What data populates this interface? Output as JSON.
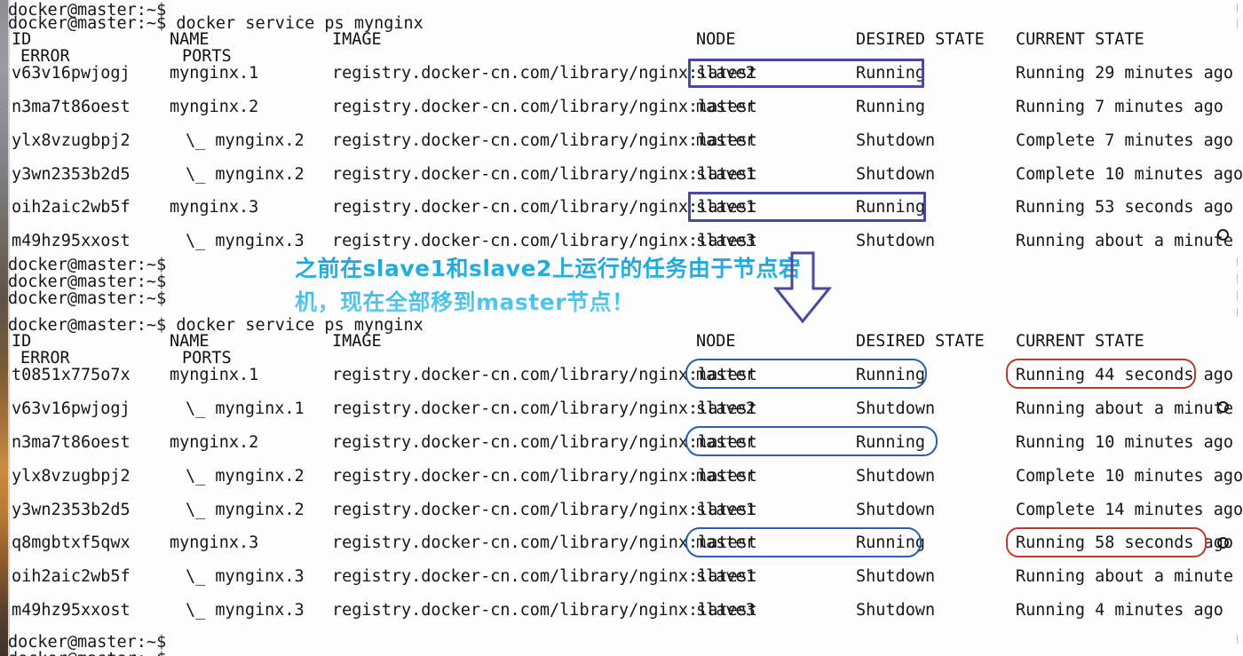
{
  "terminal": {
    "prompt": "docker@master:~$",
    "command": "docker service ps mynginx",
    "headers": {
      "id": "ID",
      "name": "NAME",
      "image": "IMAGE",
      "node": "NODE",
      "desired_state": "DESIRED STATE",
      "current_state": "CURRENT STATE",
      "error": "ERROR",
      "ports": "PORTS"
    }
  },
  "block1": {
    "blank_prompt": "docker@master:~$",
    "command_line": "docker@master:~$ docker service ps mynginx",
    "rows": [
      {
        "id": "v63v16pwjogj",
        "name": "mynginx.1",
        "image": "registry.docker-cn.com/library/nginx:latest",
        "node": "slave2",
        "desired": "Running",
        "current": "Running 29 minutes ago"
      },
      {
        "id": "n3ma7t86oest",
        "name": "mynginx.2",
        "image": "registry.docker-cn.com/library/nginx:latest",
        "node": "master",
        "desired": "Running",
        "current": "Running 7 minutes ago"
      },
      {
        "id": "ylx8vzugbpj2",
        "name": "\\_ mynginx.2",
        "image": "registry.docker-cn.com/library/nginx:latest",
        "node": "master",
        "desired": "Shutdown",
        "current": "Complete 7 minutes ago"
      },
      {
        "id": "y3wn2353b2d5",
        "name": "\\_ mynginx.2",
        "image": "registry.docker-cn.com/library/nginx:latest",
        "node": "slave1",
        "desired": "Shutdown",
        "current": "Complete 10 minutes ago"
      },
      {
        "id": "oih2aic2wb5f",
        "name": "mynginx.3",
        "image": "registry.docker-cn.com/library/nginx:latest",
        "node": "slave1",
        "desired": "Running",
        "current": "Running 53 seconds ago"
      },
      {
        "id": "m49hz95xxost",
        "name": "\\_ mynginx.3",
        "image": "registry.docker-cn.com/library/nginx:latest",
        "node": "slave3",
        "desired": "Shutdown",
        "current": "Running about a minute ago"
      }
    ]
  },
  "block2": {
    "blank_prompts": [
      "docker@master:~$",
      "docker@master:~$",
      "docker@master:~$"
    ],
    "command_line": "docker@master:~$ docker service ps mynginx",
    "rows": [
      {
        "id": "t0851x775o7x",
        "name": "mynginx.1",
        "image": "registry.docker-cn.com/library/nginx:latest",
        "node": "master",
        "desired": "Running",
        "current": "Running 44 seconds ago"
      },
      {
        "id": "v63v16pwjogj",
        "name": "\\_ mynginx.1",
        "image": "registry.docker-cn.com/library/nginx:latest",
        "node": "slave2",
        "desired": "Shutdown",
        "current": "Running about a minute ago"
      },
      {
        "id": "n3ma7t86oest",
        "name": "mynginx.2",
        "image": "registry.docker-cn.com/library/nginx:latest",
        "node": "master",
        "desired": "Running",
        "current": "Running 10 minutes ago"
      },
      {
        "id": "ylx8vzugbpj2",
        "name": "\\_ mynginx.2",
        "image": "registry.docker-cn.com/library/nginx:latest",
        "node": "master",
        "desired": "Shutdown",
        "current": "Complete 10 minutes ago"
      },
      {
        "id": "y3wn2353b2d5",
        "name": "\\_ mynginx.2",
        "image": "registry.docker-cn.com/library/nginx:latest",
        "node": "slave1",
        "desired": "Shutdown",
        "current": "Complete 14 minutes ago"
      },
      {
        "id": "q8mgbtxf5qwx",
        "name": "mynginx.3",
        "image": "registry.docker-cn.com/library/nginx:latest",
        "node": "master",
        "desired": "Running",
        "current": "Running 58 seconds ago"
      },
      {
        "id": "oih2aic2wb5f",
        "name": "\\_ mynginx.3",
        "image": "registry.docker-cn.com/library/nginx:latest",
        "node": "slave1",
        "desired": "Shutdown",
        "current": "Running about a minute ago"
      },
      {
        "id": "m49hz95xxost",
        "name": "\\_ mynginx.3",
        "image": "registry.docker-cn.com/library/nginx:latest",
        "node": "slave3",
        "desired": "Shutdown",
        "current": "Running 4 minutes ago"
      }
    ]
  },
  "footer": {
    "prompt": "docker@master:~$"
  },
  "annotation": {
    "line1": "之前在slave1和slave2上运行的任务由于节点宕",
    "line2": "机，现在全部移到master节点！",
    "color": "#1ea6d8"
  },
  "colors": {
    "highlight_blue_sharp": "#4949a0",
    "highlight_blue_round": "#2b5fae",
    "highlight_red": "#c0392b",
    "arrow_outline": "#4949a0",
    "terminal_bg": "#fdfdfd",
    "text": "#161616"
  }
}
